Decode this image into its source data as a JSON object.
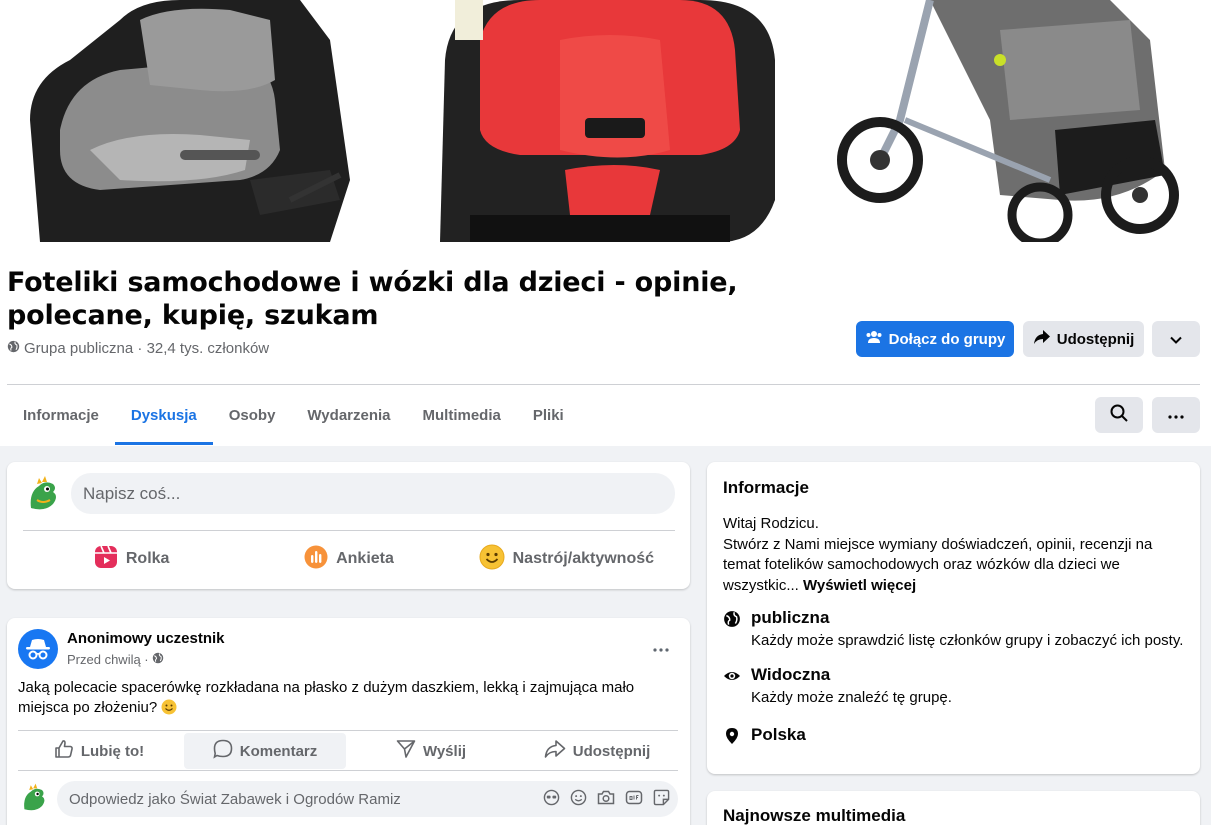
{
  "group": {
    "title": "Foteliki samochodowe i wózki dla dzieci - opinie, polecane, kupię, szukam",
    "meta": "Grupa publiczna · 32,4 tys. członków",
    "join_label": "Dołącz do grupy",
    "share_label": "Udostępnij"
  },
  "tabs": [
    {
      "label": "Informacje"
    },
    {
      "label": "Dyskusja"
    },
    {
      "label": "Osoby"
    },
    {
      "label": "Wydarzenia"
    },
    {
      "label": "Multimedia"
    },
    {
      "label": "Pliki"
    }
  ],
  "composer": {
    "placeholder": "Napisz coś...",
    "actions": [
      {
        "label": "Rolka"
      },
      {
        "label": "Ankieta"
      },
      {
        "label": "Nastrój/aktywność"
      }
    ]
  },
  "post": {
    "author": "Anonimowy uczestnik",
    "time": "Przed chwilą ·",
    "text": "Jaką polecacie spacerówkę rozkładana na płasko z dużym daszkiem, lekką i zajmująca mało miejsca po złożeniu?",
    "actions": [
      {
        "label": "Lubię to!"
      },
      {
        "label": "Komentarz"
      },
      {
        "label": "Wyślij"
      },
      {
        "label": "Udostępnij"
      }
    ],
    "reply_placeholder": "Odpowiedz jako Świat Zabawek i Ogrodów Ramiz"
  },
  "info": {
    "heading": "Informacje",
    "desc_line1": "Witaj Rodzicu.",
    "desc_line2": "Stwórz z Nami miejsce wymiany doświadczeń, opinii, recenzji na temat fotelików samochodowych oraz wózków dla dzieci we wszystkic...",
    "see_more": "Wyświetl więcej",
    "rows": [
      {
        "title": "publiczna",
        "sub": "Każdy może sprawdzić listę członków grupy i zobaczyć ich posty."
      },
      {
        "title": "Widoczna",
        "sub": "Każdy może znaleźć tę grupę."
      },
      {
        "title": "Polska",
        "sub": ""
      }
    ]
  },
  "media": {
    "heading": "Najnowsze multimedia"
  },
  "colors": {
    "accent": "#1b74e4",
    "muted": "#65676b",
    "background": "#f0f2f5"
  }
}
